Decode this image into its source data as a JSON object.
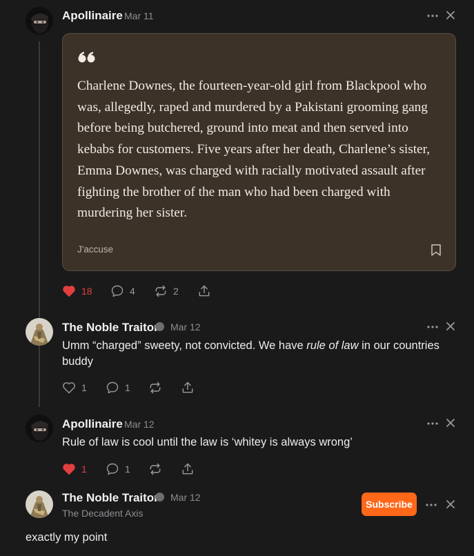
{
  "comments": [
    {
      "author": "Apollinaire",
      "date": "Mar 11",
      "quote": {
        "text": "Charlene Downes, the fourteen-year-old girl from Blackpool who was, allegedly, raped and murdered by a Pakistani grooming gang before being butchered, ground into meat and then served into kebabs for customers. Five years after her death, Charlene’s sister, Emma Downes, was charged with racially motivated assault after fighting the brother of the man who had been charged with murdering her sister.",
        "source": "J'accuse"
      },
      "likes": "18",
      "replies": "4",
      "restacks": "2",
      "liked": true
    },
    {
      "author": "The Noble Traitor",
      "date": "Mar 12",
      "text_before": "Umm “charged” sweety, not convicted. We have ",
      "text_italic": "rule of law",
      "text_after": " in our countries buddy",
      "likes": "1",
      "replies": "1",
      "liked": false
    },
    {
      "author": "Apollinaire",
      "date": "Mar 12",
      "text": "Rule of law is cool until the law is ‘whitey is always wrong’",
      "likes": "1",
      "replies": "1",
      "liked": true
    },
    {
      "author": "The Noble Traitor",
      "date": "Mar 12",
      "publication": "The Decadent Axis",
      "subscribe_label": "Subscribe",
      "text": "exactly my point"
    }
  ],
  "icons": {
    "more": "more-horizontal-icon",
    "close": "close-icon",
    "like": "heart-icon",
    "reply": "comment-icon",
    "restack": "restack-icon",
    "share": "share-icon",
    "bookmark": "bookmark-icon",
    "quote": "quote-mark-icon"
  },
  "colors": {
    "background": "#1a1a1b",
    "quote_card": "#3c3228",
    "like_active": "#e23e3e",
    "subscribe": "#ff6719"
  }
}
